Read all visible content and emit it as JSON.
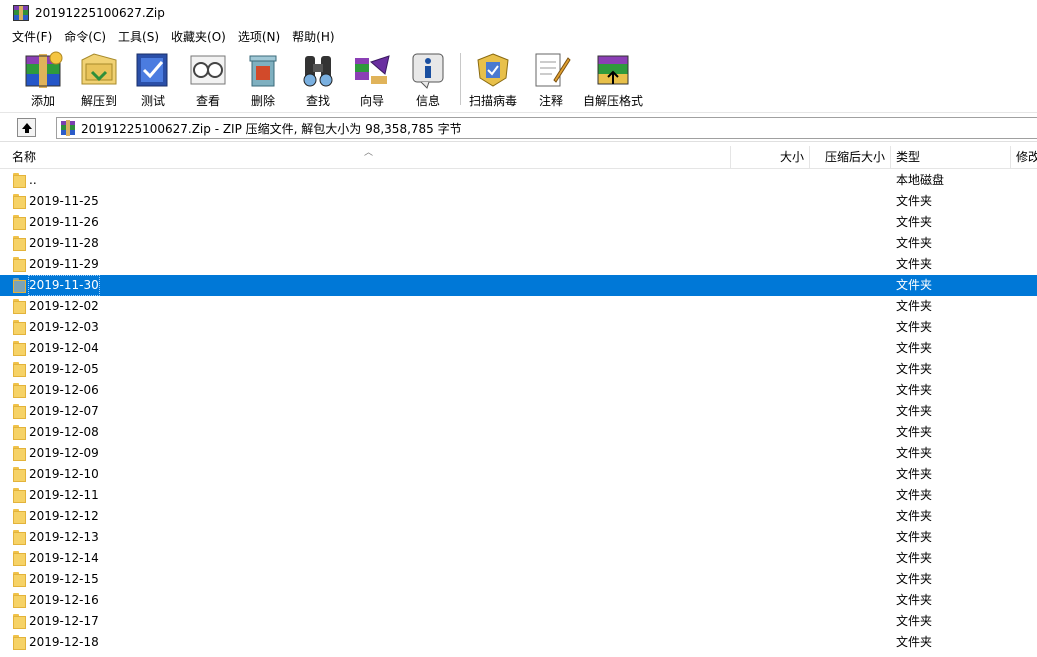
{
  "window": {
    "title": "20191225100627.Zip"
  },
  "menu": [
    "文件(F)",
    "命令(C)",
    "工具(S)",
    "收藏夹(O)",
    "选项(N)",
    "帮助(H)"
  ],
  "toolbar": {
    "buttons": [
      {
        "label": "添加",
        "icon": "add-archive-icon"
      },
      {
        "label": "解压到",
        "icon": "extract-to-icon"
      },
      {
        "label": "测试",
        "icon": "test-icon"
      },
      {
        "label": "查看",
        "icon": "view-icon"
      },
      {
        "label": "删除",
        "icon": "delete-icon"
      },
      {
        "label": "查找",
        "icon": "find-icon"
      },
      {
        "label": "向导",
        "icon": "wizard-icon"
      },
      {
        "label": "信息",
        "icon": "info-icon"
      },
      {
        "label": "扫描病毒",
        "icon": "virus-scan-icon"
      },
      {
        "label": "注释",
        "icon": "comment-icon"
      },
      {
        "label": "自解压格式",
        "icon": "sfx-icon"
      }
    ]
  },
  "address": {
    "text": "20191225100627.Zip - ZIP 压缩文件, 解包大小为 98,358,785 字节"
  },
  "columns": {
    "name": "名称",
    "size": "大小",
    "packed": "压缩后大小",
    "type": "类型",
    "modified": "修改"
  },
  "rows": [
    {
      "name": "..",
      "type": "本地磁盘"
    },
    {
      "name": "2019-11-25",
      "type": "文件夹"
    },
    {
      "name": "2019-11-26",
      "type": "文件夹"
    },
    {
      "name": "2019-11-28",
      "type": "文件夹"
    },
    {
      "name": "2019-11-29",
      "type": "文件夹"
    },
    {
      "name": "2019-11-30",
      "type": "文件夹",
      "selected": true
    },
    {
      "name": "2019-12-02",
      "type": "文件夹"
    },
    {
      "name": "2019-12-03",
      "type": "文件夹"
    },
    {
      "name": "2019-12-04",
      "type": "文件夹"
    },
    {
      "name": "2019-12-05",
      "type": "文件夹"
    },
    {
      "name": "2019-12-06",
      "type": "文件夹"
    },
    {
      "name": "2019-12-07",
      "type": "文件夹"
    },
    {
      "name": "2019-12-08",
      "type": "文件夹"
    },
    {
      "name": "2019-12-09",
      "type": "文件夹"
    },
    {
      "name": "2019-12-10",
      "type": "文件夹"
    },
    {
      "name": "2019-12-11",
      "type": "文件夹"
    },
    {
      "name": "2019-12-12",
      "type": "文件夹"
    },
    {
      "name": "2019-12-13",
      "type": "文件夹"
    },
    {
      "name": "2019-12-14",
      "type": "文件夹"
    },
    {
      "name": "2019-12-15",
      "type": "文件夹"
    },
    {
      "name": "2019-12-16",
      "type": "文件夹"
    },
    {
      "name": "2019-12-17",
      "type": "文件夹"
    },
    {
      "name": "2019-12-18",
      "type": "文件夹"
    }
  ],
  "colors": {
    "selection": "#0078d7",
    "folder": "#f6d266"
  }
}
